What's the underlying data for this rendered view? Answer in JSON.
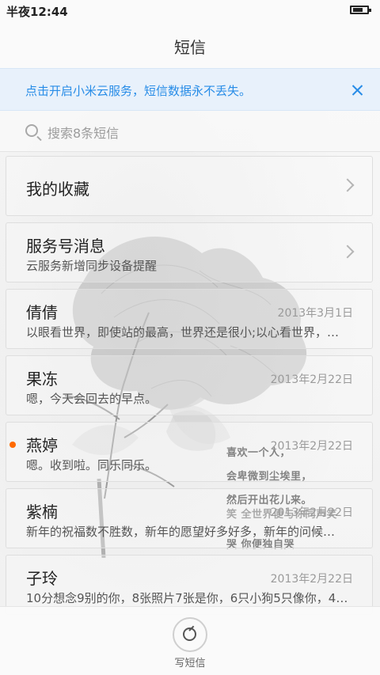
{
  "status_bar": {
    "time": "半夜12:44",
    "battery_icon": "battery-icon"
  },
  "header": {
    "title": "短信"
  },
  "banner": {
    "text": "点击开启小米云服务，短信数据永不丢失。",
    "close_icon": "close-icon",
    "accent_color": "#278ce7"
  },
  "search": {
    "placeholder": "搜索8条短信",
    "icon": "search-icon"
  },
  "conversations": [
    {
      "title": "我的收藏",
      "subtitle": "",
      "date": "",
      "has_chevron": true,
      "unread": false
    },
    {
      "title": "服务号消息",
      "subtitle": "云服务新增同步设备提醒",
      "date": "",
      "has_chevron": true,
      "unread": false
    },
    {
      "title": "倩倩",
      "subtitle": "以眼看世界，即使站的最高，世界还是很小;以心看世界，…",
      "date": "2013年3月1日",
      "has_chevron": false,
      "unread": false
    },
    {
      "title": "果冻",
      "subtitle": "嗯，今天会回去的早点。",
      "date": "2013年2月22日",
      "has_chevron": false,
      "unread": false
    },
    {
      "title": "燕婷",
      "subtitle": "嗯。收到啦。同乐同乐。",
      "date": "2013年2月22日",
      "has_chevron": false,
      "unread": true
    },
    {
      "title": "紫楠",
      "subtitle": "新年的祝福数不胜数，新年的愿望好多好多，新年的问候…",
      "date": "2013年2月22日",
      "has_chevron": false,
      "unread": false
    },
    {
      "title": "子玲",
      "subtitle": "10分想念9别的你，8张照片7张是你，6只小狗5只像你，4…",
      "date": "2013年2月22日",
      "has_chevron": false,
      "unread": false
    }
  ],
  "wallpaper": {
    "poem_lines": [
      "喜欢一个人，",
      "会卑微到尘埃里，",
      "然后开出花儿来。",
      "笑 全世界便与你同声笑",
      "哭 你便独自哭"
    ]
  },
  "bottom_bar": {
    "compose_label": "写短信",
    "compose_icon": "compose-icon"
  },
  "colors": {
    "unread_dot": "#ff6a00",
    "banner_background": "#e8f1fb"
  }
}
